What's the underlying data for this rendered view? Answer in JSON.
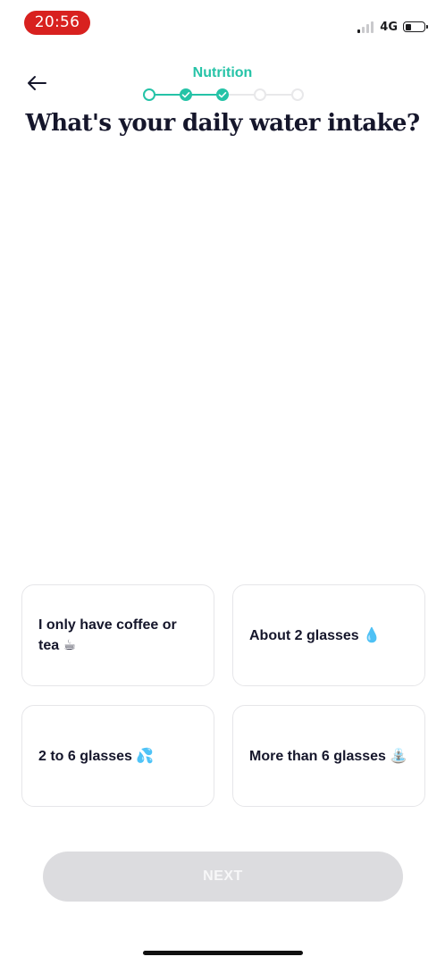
{
  "status_bar": {
    "time": "20:56",
    "network": "4G",
    "signal_bars_active": 1,
    "signal_bars_total": 4,
    "battery_level": 0.35
  },
  "header": {
    "back_icon": "arrow-left-icon",
    "section": "Nutrition",
    "progress": {
      "total_steps": 5,
      "current_step": 1,
      "completed_steps": [
        2,
        3
      ]
    }
  },
  "question": "What's your daily water intake?",
  "options": [
    {
      "label": "I only have coffee or tea ☕"
    },
    {
      "label": "About 2 glasses 💧"
    },
    {
      "label": "2 to 6 glasses 💦"
    },
    {
      "label": "More than 6 glasses ⛲"
    }
  ],
  "next_button": {
    "label": "NEXT",
    "enabled": false
  },
  "colors": {
    "accent": "#25c3a7",
    "status_time_bg": "#d8211f",
    "inactive": "#dcdcdf",
    "title": "#15162b"
  }
}
